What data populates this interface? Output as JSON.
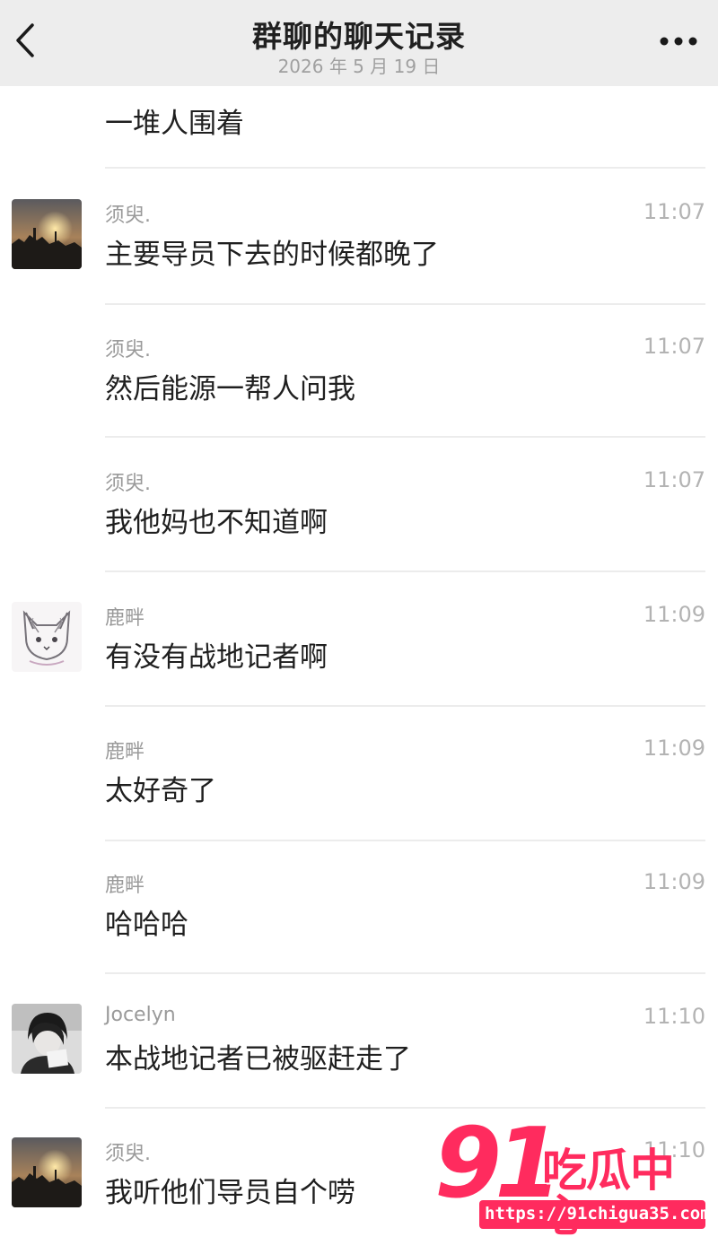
{
  "header": {
    "title": "群聊的聊天记录",
    "date": "2026 年 5 月 19 日"
  },
  "partial_message": {
    "text": "一堆人围着"
  },
  "messages": [
    {
      "sender": "须臾.",
      "time": "11:07",
      "text": "主要导员下去的时候都晚了",
      "avatar": "sunset"
    },
    {
      "sender": "须臾.",
      "time": "11:07",
      "text": "然后能源一帮人问我",
      "avatar": ""
    },
    {
      "sender": "须臾.",
      "time": "11:07",
      "text": "我他妈也不知道啊",
      "avatar": ""
    },
    {
      "sender": "鹿畔",
      "time": "11:09",
      "text": "有没有战地记者啊",
      "avatar": "cat-sketch"
    },
    {
      "sender": "鹿畔",
      "time": "11:09",
      "text": "太好奇了",
      "avatar": ""
    },
    {
      "sender": "鹿畔",
      "time": "11:09",
      "text": "哈哈哈",
      "avatar": ""
    },
    {
      "sender": "Jocelyn",
      "time": "11:10",
      "text": "本战地记者已被驱赶走了",
      "avatar": "person-bw"
    },
    {
      "sender": "须臾.",
      "time": "11:10",
      "text": "我听他们导员自个唠",
      "avatar": "sunset"
    }
  ],
  "watermark": {
    "number": "91",
    "name": "吃瓜中心",
    "url": "https://91chigua35.com",
    "color": "#ff2b5e"
  },
  "icons": {
    "back": "chevron-left-icon",
    "more": "more-dots-icon"
  }
}
